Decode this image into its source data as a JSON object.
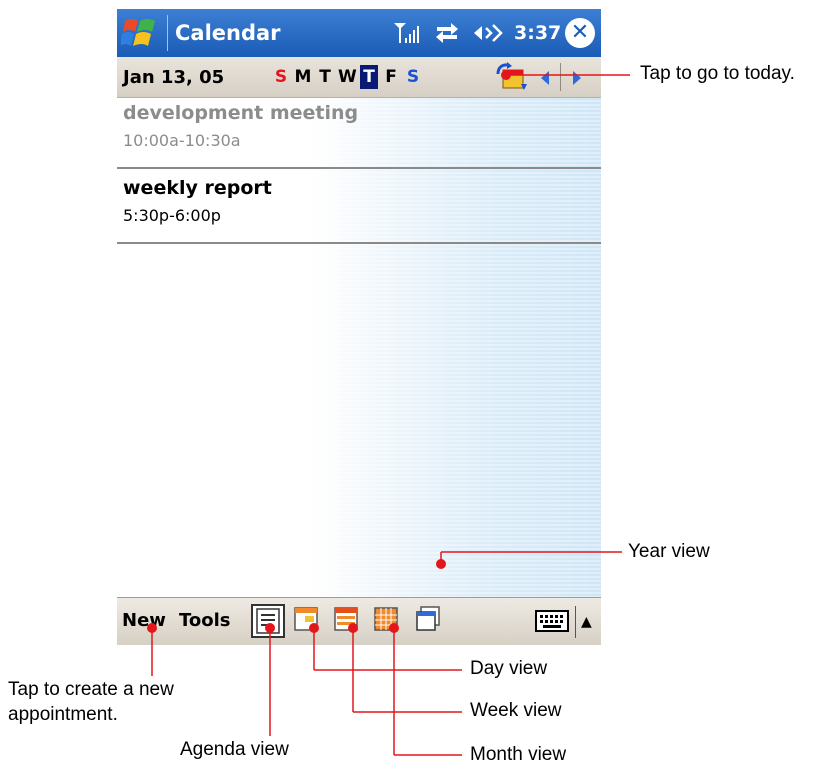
{
  "title_bar": {
    "app_title": "Calendar",
    "clock": "3:37",
    "close_glyph": "✕",
    "icons": [
      "windows-start-icon",
      "signal-icon",
      "sync-icon",
      "speaker-icon",
      "close-icon"
    ]
  },
  "date_bar": {
    "date": "Jan 13, 05",
    "days": [
      "S",
      "M",
      "T",
      "W",
      "T",
      "F",
      "S"
    ],
    "selected_day_index": 4,
    "icons": [
      "go-to-today-icon",
      "prev-arrow-icon",
      "next-arrow-icon"
    ]
  },
  "appointments": [
    {
      "title": "development meeting",
      "time": "10:00a-10:30a",
      "dimmed": true
    },
    {
      "title": "weekly report",
      "time": "5:30p-6:00p",
      "dimmed": false
    }
  ],
  "toolbar": {
    "new_label": "New",
    "tools_label": "Tools",
    "views": [
      "agenda-view-icon",
      "day-view-icon",
      "week-view-icon",
      "month-view-icon",
      "year-view-icon"
    ],
    "active_view": "agenda",
    "sip_arrow": "▲"
  },
  "callouts": {
    "today": "Tap to go to today.",
    "year": "Year view",
    "day": "Day view",
    "week": "Week view",
    "month": "Month view",
    "new_line1": "Tap to create a new",
    "new_line2": "appointment.",
    "agenda": "Agenda view"
  },
  "colors": {
    "title_bar": "#1a5cb6",
    "callout_line": "#e3161b",
    "sunday": "#e3161b",
    "saturday": "#1b4fd6",
    "today_highlight": "#0a1a74"
  }
}
